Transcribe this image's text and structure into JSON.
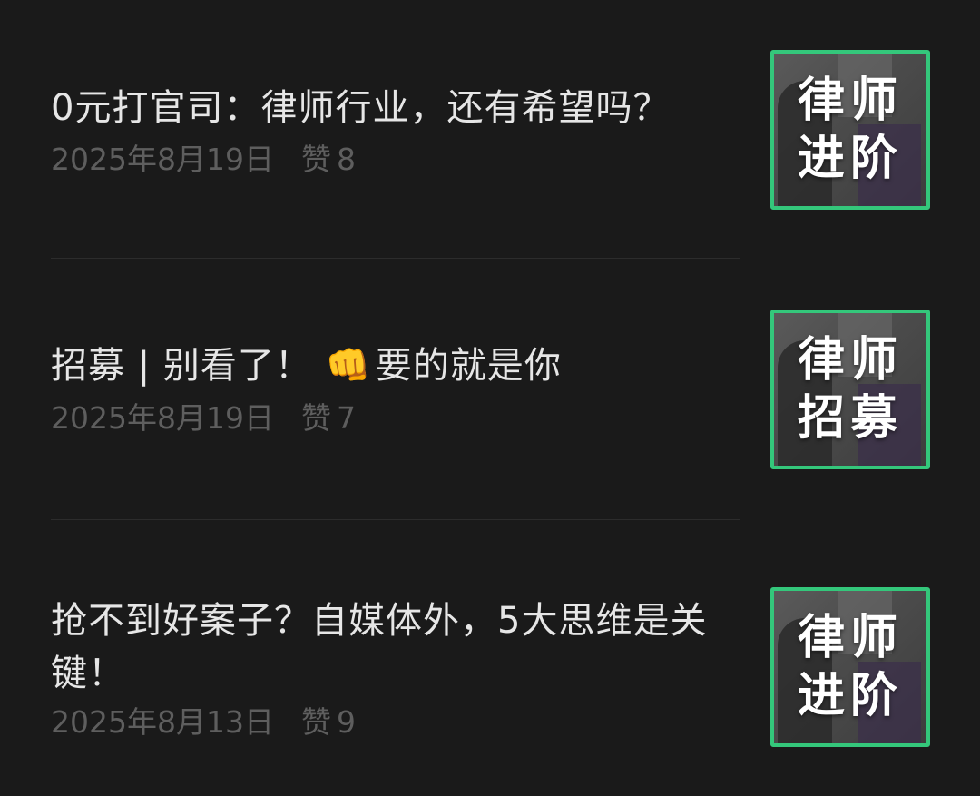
{
  "articles": [
    {
      "title": "0元打官司：律师行业，还有希望吗？",
      "date": "2025年8月19日",
      "likes_label": "赞",
      "likes_count": "8",
      "thumbnail": {
        "line1": "律师",
        "line2": "进阶",
        "border_color": "#34c77b"
      }
    },
    {
      "title_before_emoji": "招募 | 别看了！",
      "emoji": "👊",
      "title_after_emoji": "要的就是你",
      "date": "2025年8月19日",
      "likes_label": "赞",
      "likes_count": "7",
      "thumbnail": {
        "line1": "律师",
        "line2": "招募",
        "border_color": "#34c77b"
      }
    },
    {
      "title": "抢不到好案子？自媒体外，5大思维是关键！",
      "date": "2025年8月13日",
      "likes_label": "赞",
      "likes_count": "9",
      "thumbnail": {
        "line1": "律师",
        "line2": "进阶",
        "border_color": "#34c77b"
      }
    }
  ]
}
